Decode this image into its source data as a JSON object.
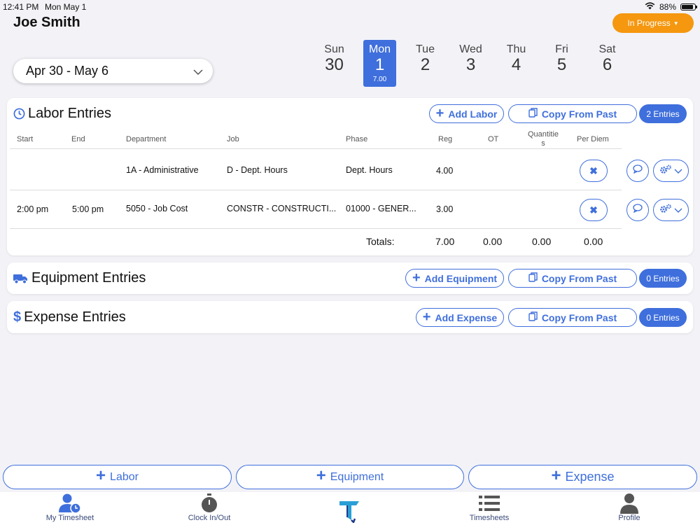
{
  "status_bar": {
    "time": "12:41 PM",
    "date": "Mon May 1",
    "battery": "88%",
    "battery_level": 0.88
  },
  "header": {
    "user_name": "Joe Smith",
    "status_label": "In Progress"
  },
  "week_select": {
    "label": "Apr 30 - May 6"
  },
  "days": [
    {
      "name": "Sun",
      "num": "30",
      "hours": ""
    },
    {
      "name": "Mon",
      "num": "1",
      "hours": "7.00"
    },
    {
      "name": "Tue",
      "num": "2",
      "hours": ""
    },
    {
      "name": "Wed",
      "num": "3",
      "hours": ""
    },
    {
      "name": "Thu",
      "num": "4",
      "hours": ""
    },
    {
      "name": "Fri",
      "num": "5",
      "hours": ""
    },
    {
      "name": "Sat",
      "num": "6",
      "hours": ""
    }
  ],
  "labor": {
    "title": "Labor Entries",
    "add_label": "Add Labor",
    "copy_label": "Copy From Past",
    "count_label": "2 Entries",
    "columns": [
      "Start",
      "End",
      "Department",
      "Job",
      "Phase",
      "Reg",
      "OT",
      "Quantitie\ns",
      "Per Diem"
    ],
    "rows": [
      {
        "start": "",
        "end": "",
        "department": "1A - Administrative",
        "job": "D - Dept. Hours",
        "phase": "Dept. Hours",
        "reg": "4.00"
      },
      {
        "start": "2:00 pm",
        "end": "5:00 pm",
        "department": "5050 - Job Cost",
        "job": "CONSTR - CONSTRUCTI...",
        "phase": "01000 - GENER...",
        "reg": "3.00"
      }
    ],
    "totals": {
      "label": "Totals:",
      "reg": "7.00",
      "ot": "0.00",
      "quantities": "0.00",
      "per_diem": "0.00"
    }
  },
  "equipment": {
    "title": "Equipment Entries",
    "add_label": "Add Equipment",
    "copy_label": "Copy From Past",
    "count_label": "0 Entries"
  },
  "expense": {
    "title": "Expense Entries",
    "add_label": "Add Expense",
    "copy_label": "Copy From Past",
    "count_label": "0 Entries"
  },
  "bottom_buttons": {
    "labor": "Labor",
    "equipment": "Equipment",
    "expense": "Expense"
  },
  "tabs": [
    {
      "label": "My Timesheet",
      "icon": "user-clock-icon"
    },
    {
      "label": "Clock In/Out",
      "icon": "stopwatch-icon"
    },
    {
      "label": "",
      "icon": "app-logo-icon"
    },
    {
      "label": "Timesheets",
      "icon": "list-icon"
    },
    {
      "label": "Profile",
      "icon": "user-icon"
    }
  ],
  "colors": {
    "accent": "#3f6fdc",
    "status": "#f5970f"
  }
}
